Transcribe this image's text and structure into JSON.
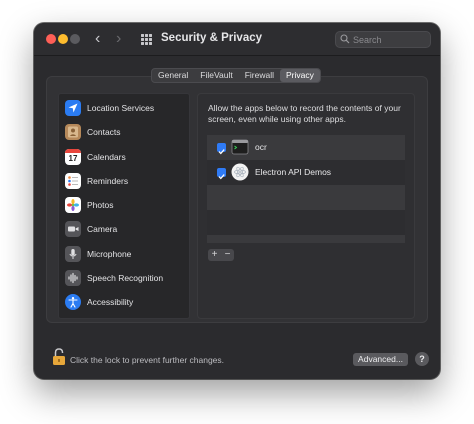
{
  "window": {
    "title": "Security & Privacy",
    "nav_back": "‹",
    "nav_forward": "›"
  },
  "search": {
    "placeholder": "Search",
    "value": ""
  },
  "tabs": [
    {
      "label": "General",
      "active": false
    },
    {
      "label": "FileVault",
      "active": false
    },
    {
      "label": "Firewall",
      "active": false
    },
    {
      "label": "Privacy",
      "active": true
    }
  ],
  "sidebar": {
    "items": [
      {
        "label": "Location Services",
        "icon": "location-icon",
        "selected": false
      },
      {
        "label": "Contacts",
        "icon": "contacts-icon",
        "selected": false
      },
      {
        "label": "Calendars",
        "icon": "calendar-icon",
        "day": "17",
        "selected": false
      },
      {
        "label": "Reminders",
        "icon": "reminders-icon",
        "selected": false
      },
      {
        "label": "Photos",
        "icon": "photos-icon",
        "selected": false
      },
      {
        "label": "Camera",
        "icon": "camera-icon",
        "selected": false
      },
      {
        "label": "Microphone",
        "icon": "microphone-icon",
        "selected": false
      },
      {
        "label": "Speech Recognition",
        "icon": "speech-recognition-icon",
        "selected": false
      },
      {
        "label": "Accessibility",
        "icon": "accessibility-icon",
        "selected": false
      }
    ]
  },
  "main": {
    "description": "Allow the apps below to record the contents of your screen, even while using other apps.",
    "apps": [
      {
        "name": "ocr",
        "checked": true,
        "icon": "terminal-app-icon"
      },
      {
        "name": "Electron API Demos",
        "checked": true,
        "icon": "electron-app-icon"
      }
    ],
    "add_label": "+",
    "remove_label": "−"
  },
  "footer": {
    "lock_text": "Click the lock to prevent further changes.",
    "advanced_label": "Advanced...",
    "help_label": "?"
  },
  "colors": {
    "accent": "#2f7bf6",
    "window_bg": "#2b2b2e",
    "lock": "#e7a73a"
  }
}
